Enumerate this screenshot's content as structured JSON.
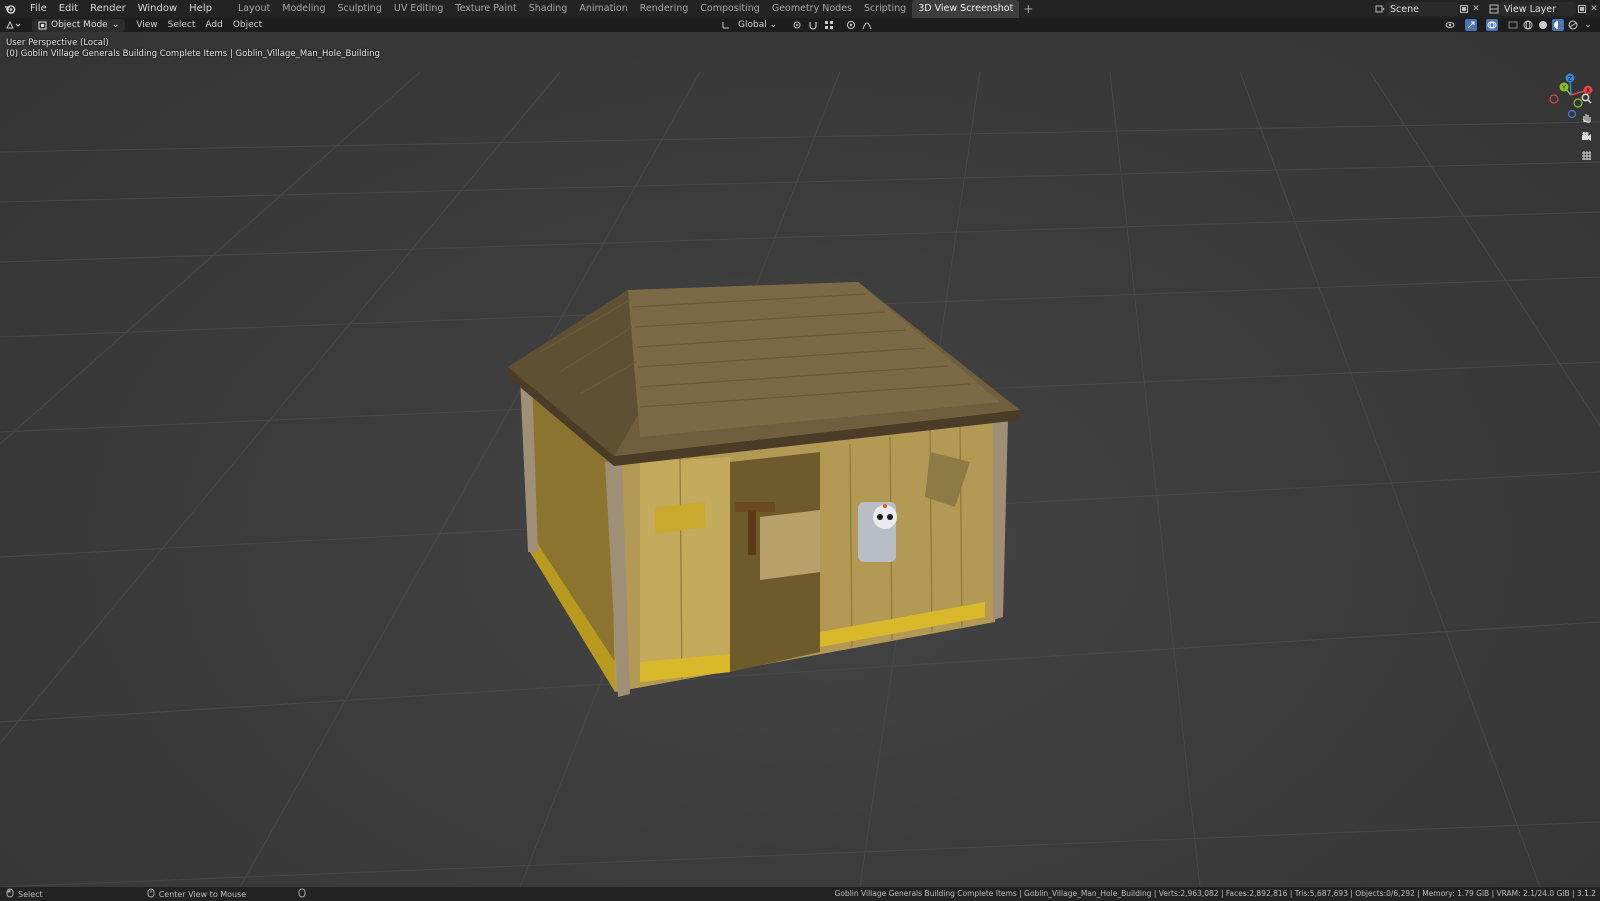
{
  "topbar": {
    "menus": [
      "File",
      "Edit",
      "Render",
      "Window",
      "Help"
    ],
    "workspaces": [
      "Layout",
      "Modeling",
      "Sculpting",
      "UV Editing",
      "Texture Paint",
      "Shading",
      "Animation",
      "Rendering",
      "Compositing",
      "Geometry Nodes",
      "Scripting",
      "3D View Screenshot"
    ],
    "active_workspace": "3D View Screenshot",
    "add_tab": "+",
    "scene_name": "Scene",
    "view_layer_name": "View Layer"
  },
  "header": {
    "mode": "Object Mode",
    "menus": [
      "View",
      "Select",
      "Add",
      "Object"
    ],
    "transform_orientation": "Global"
  },
  "viewport": {
    "perspective_label": "User Perspective (Local)",
    "object_label": "(0) Goblin Village Generals Building Complete Items | Goblin_Village_Man_Hole_Building",
    "gizmo": {
      "x_label": "X",
      "y_label": "Y",
      "z_label": "Z"
    }
  },
  "statusbar": {
    "select_label": "Select",
    "center_label": "Center View to Mouse",
    "stats": "Goblin Village Generals Building Complete Items | Goblin_Village_Man_Hole_Building | Verts:2,963,082 | Faces:2,892,816 | Tris:5,687,693 | Objects:0/6,292 | Memory: 1.79 GiB | VRAM: 2.1/24.0 GiB | 3.1.2"
  },
  "colors": {
    "topbar_bg": "#232323",
    "viewport_bg": "#3c3c3c",
    "accent": "#4772b3",
    "axis_x": "#e0434b",
    "axis_y": "#8ac22f",
    "axis_z": "#3b82d6"
  }
}
